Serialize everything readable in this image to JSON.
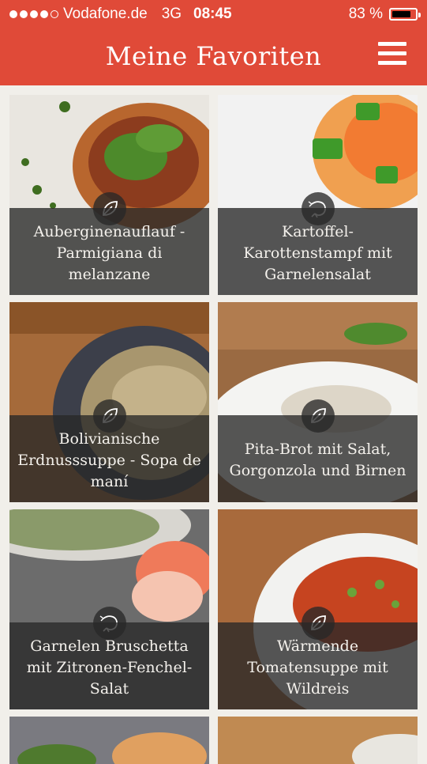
{
  "status_bar": {
    "carrier": "Vodafone.de",
    "network": "3G",
    "time": "08:45",
    "battery_text": "83 %",
    "battery_level": 0.83,
    "signal_bars": 4,
    "signal_total": 5
  },
  "header": {
    "title": "Meine Favoriten",
    "menu_icon": "hamburger-menu-icon",
    "color": "#e04a38"
  },
  "recipes": [
    {
      "title": "Auberginenauflauf - Parmigiana di melanzane",
      "icon": "leaf-icon"
    },
    {
      "title": "Kartoffel-Karottenstampf mit Garnelensalat",
      "icon": "shrimp-icon"
    },
    {
      "title": "Bolivianische Erdnusssuppe - Sopa de maní",
      "icon": "leaf-icon"
    },
    {
      "title": "Pita-Brot mit Salat, Gorgonzola und Birnen",
      "icon": "leaf-icon"
    },
    {
      "title": "Garnelen Bruschetta mit Zitronen-Fenchel-Salat",
      "icon": "shrimp-icon"
    },
    {
      "title": "Wärmende Tomatensuppe mit Wildreis",
      "icon": "leaf-icon"
    }
  ]
}
